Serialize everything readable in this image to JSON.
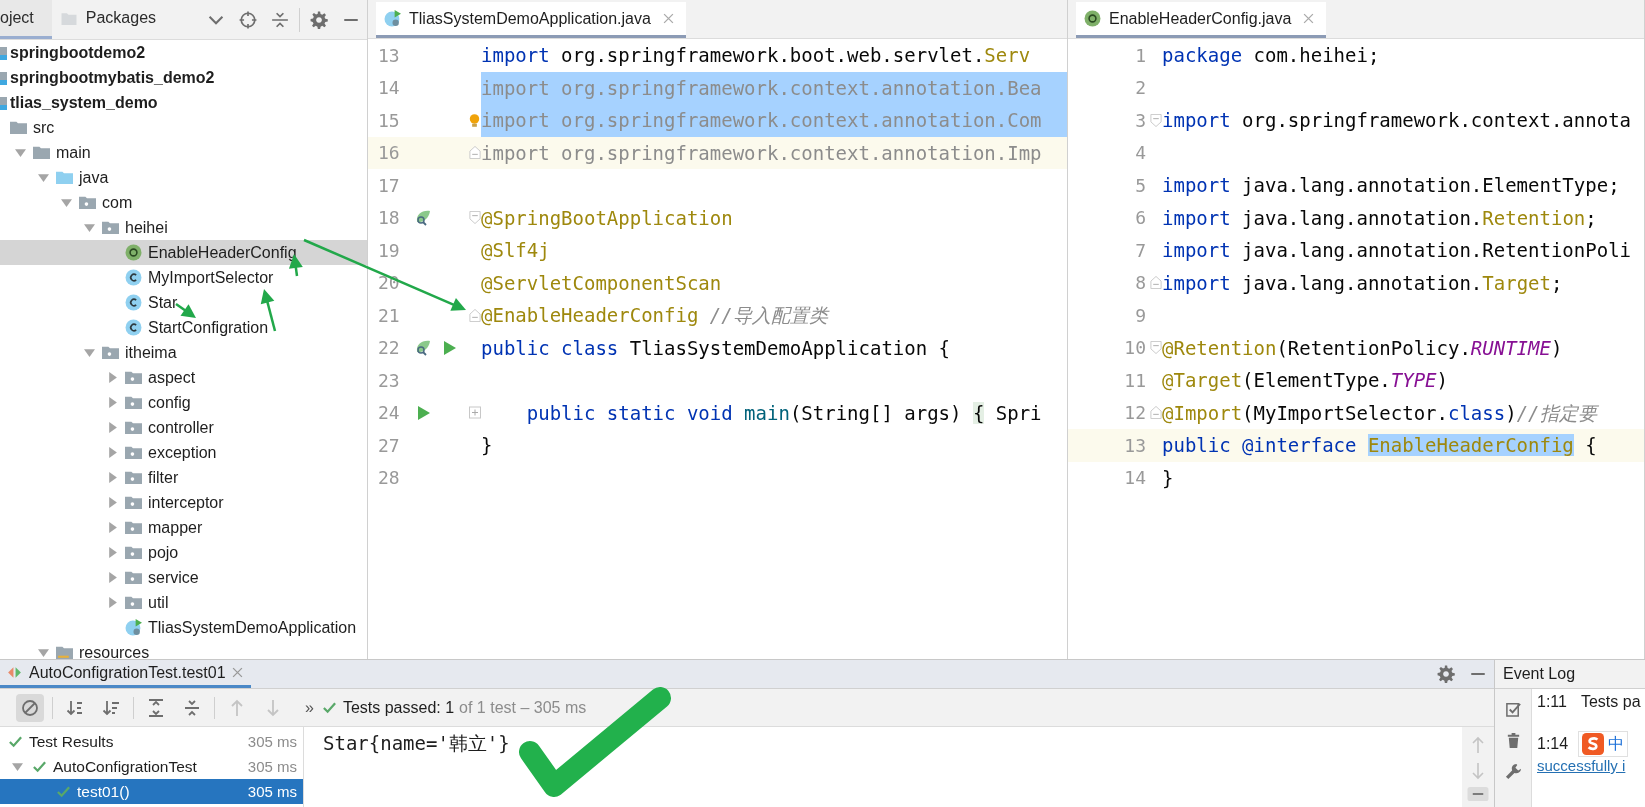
{
  "project": {
    "tabs": [
      {
        "label": "oject",
        "selected": true
      },
      {
        "label": "Packages",
        "selected": false
      }
    ],
    "tree": [
      {
        "label": "springbootdemo2",
        "kind": "module",
        "selected": false
      },
      {
        "label": "springbootmybatis_demo2",
        "kind": "module",
        "selected": false
      },
      {
        "label": "tlias_system_demo",
        "kind": "module",
        "selected": false,
        "children": [
          {
            "label": "src",
            "kind": "folder",
            "selected": false,
            "children": [
              {
                "label": "main",
                "kind": "folder",
                "expanded": true,
                "selected": false,
                "children": [
                  {
                    "label": "java",
                    "kind": "source-root",
                    "expanded": true,
                    "selected": false,
                    "children": [
                      {
                        "label": "com",
                        "kind": "package",
                        "expanded": true,
                        "selected": false,
                        "children": [
                          {
                            "label": "heihei",
                            "kind": "package",
                            "expanded": true,
                            "selected": false,
                            "children": [
                              {
                                "label": "EnableHeaderConfig",
                                "kind": "annotation",
                                "selected": true
                              },
                              {
                                "label": "MyImportSelector",
                                "kind": "class",
                                "selected": false
                              },
                              {
                                "label": "Star",
                                "kind": "class",
                                "selected": false
                              },
                              {
                                "label": "StartConfigration",
                                "kind": "class",
                                "selected": false
                              }
                            ]
                          },
                          {
                            "label": "itheima",
                            "kind": "package",
                            "expanded": true,
                            "selected": false,
                            "children": [
                              {
                                "label": "aspect",
                                "kind": "package",
                                "expanded": false,
                                "selected": false
                              },
                              {
                                "label": "config",
                                "kind": "package",
                                "expanded": false,
                                "selected": false
                              },
                              {
                                "label": "controller",
                                "kind": "package",
                                "expanded": false,
                                "selected": false
                              },
                              {
                                "label": "exception",
                                "kind": "package",
                                "expanded": false,
                                "selected": false
                              },
                              {
                                "label": "filter",
                                "kind": "package",
                                "expanded": false,
                                "selected": false
                              },
                              {
                                "label": "interceptor",
                                "kind": "package",
                                "expanded": false,
                                "selected": false
                              },
                              {
                                "label": "mapper",
                                "kind": "package",
                                "expanded": false,
                                "selected": false
                              },
                              {
                                "label": "pojo",
                                "kind": "package",
                                "expanded": false,
                                "selected": false
                              },
                              {
                                "label": "service",
                                "kind": "package",
                                "expanded": false,
                                "selected": false
                              },
                              {
                                "label": "util",
                                "kind": "package",
                                "expanded": false,
                                "selected": false
                              },
                              {
                                "label": "TliasSystemDemoApplication",
                                "kind": "app-class",
                                "selected": false
                              }
                            ]
                          }
                        ]
                      }
                    ]
                  },
                  {
                    "label": "resources",
                    "kind": "resources",
                    "expanded": true,
                    "selected": false
                  }
                ]
              }
            ]
          }
        ]
      }
    ]
  },
  "editors": [
    {
      "tab": {
        "label": "TliasSystemDemoApplication.java",
        "kind": "app-class",
        "selected": true
      },
      "lines": [
        {
          "num": "13",
          "selected": false,
          "current": false,
          "tokens": [
            {
              "t": "import",
              "kind": "kw"
            },
            {
              "t": " org.springframework.boot.web.servlet.",
              "kind": "plain"
            },
            {
              "t": "Serv",
              "kind": "ann"
            }
          ]
        },
        {
          "num": "14",
          "selected": true,
          "current": false,
          "tokens": [
            {
              "t": "import org.springframework.context.annotation.Bea",
              "kind": "unused"
            }
          ]
        },
        {
          "num": "15",
          "selected": true,
          "current": false,
          "intention": true,
          "tokens": [
            {
              "t": "import org.springframework.context.annotation.Com",
              "kind": "unused"
            }
          ]
        },
        {
          "num": "16",
          "selected": false,
          "current": true,
          "fold_end": true,
          "tokens": [
            {
              "t": "import org.springframework.context.annotation.Imp",
              "kind": "unused"
            }
          ]
        },
        {
          "num": "17",
          "selected": false,
          "current": false
        },
        {
          "num": "18",
          "selected": false,
          "current": false,
          "fold_start": true,
          "bean": true,
          "tokens": [
            {
              "t": "@SpringBootApplication",
              "kind": "ann"
            }
          ]
        },
        {
          "num": "19",
          "selected": false,
          "current": false,
          "tokens": [
            {
              "t": "@Slf4j",
              "kind": "ann"
            }
          ]
        },
        {
          "num": "20",
          "selected": false,
          "current": false,
          "tokens": [
            {
              "t": "@ServletComponentScan",
              "kind": "ann"
            }
          ]
        },
        {
          "num": "21",
          "selected": false,
          "current": false,
          "fold_end": true,
          "tokens": [
            {
              "t": "@EnableHeaderConfig",
              "kind": "ann"
            },
            {
              "t": " //导入配置类",
              "kind": "comment"
            }
          ]
        },
        {
          "num": "22",
          "selected": false,
          "current": false,
          "bean": true,
          "run": true,
          "tokens": [
            {
              "t": "public class",
              "kind": "kw"
            },
            {
              "t": " TliasSystemDemoApplication {",
              "kind": "plain"
            }
          ]
        },
        {
          "num": "23",
          "selected": false,
          "current": false
        },
        {
          "num": "24",
          "selected": false,
          "current": false,
          "collapsed": true,
          "run": true,
          "tokens": [
            {
              "t": "    public static void",
              "kind": "kw"
            },
            {
              "t": " main",
              "kind": "method"
            },
            {
              "t": "(String[] args) ",
              "kind": "plain"
            },
            {
              "t": "{",
              "kind": "folded"
            },
            {
              "t": " Spri",
              "kind": "plain"
            }
          ]
        },
        {
          "num": "27",
          "selected": false,
          "current": false,
          "tokens": [
            {
              "t": "}",
              "kind": "plain"
            }
          ]
        },
        {
          "num": "28",
          "selected": false,
          "current": false
        }
      ]
    },
    {
      "tab": {
        "label": "EnableHeaderConfig.java",
        "kind": "annotation",
        "selected": true
      },
      "lines": [
        {
          "num": "1",
          "selected": false,
          "current": false,
          "tokens": [
            {
              "t": "package",
              "kind": "kw"
            },
            {
              "t": " com.heihei;",
              "kind": "plain"
            }
          ]
        },
        {
          "num": "2",
          "selected": false,
          "current": false
        },
        {
          "num": "3",
          "selected": false,
          "current": false,
          "fold_start": true,
          "tokens": [
            {
              "t": "import",
              "kind": "kw"
            },
            {
              "t": " org.springframework.context.annota",
              "kind": "plain"
            }
          ]
        },
        {
          "num": "4",
          "selected": false,
          "current": false
        },
        {
          "num": "5",
          "selected": false,
          "current": false,
          "tokens": [
            {
              "t": "import",
              "kind": "kw"
            },
            {
              "t": " java.lang.annotation.ElementType;",
              "kind": "plain"
            }
          ]
        },
        {
          "num": "6",
          "selected": false,
          "current": false,
          "tokens": [
            {
              "t": "import",
              "kind": "kw"
            },
            {
              "t": " java.lang.annotation.",
              "kind": "plain"
            },
            {
              "t": "Retention",
              "kind": "ann"
            },
            {
              "t": ";",
              "kind": "plain"
            }
          ]
        },
        {
          "num": "7",
          "selected": false,
          "current": false,
          "tokens": [
            {
              "t": "import",
              "kind": "kw"
            },
            {
              "t": " java.lang.annotation.RetentionPoli",
              "kind": "plain"
            }
          ]
        },
        {
          "num": "8",
          "selected": false,
          "current": false,
          "fold_end": true,
          "tokens": [
            {
              "t": "import",
              "kind": "kw"
            },
            {
              "t": " java.lang.annotation.",
              "kind": "plain"
            },
            {
              "t": "Target",
              "kind": "ann"
            },
            {
              "t": ";",
              "kind": "plain"
            }
          ]
        },
        {
          "num": "9",
          "selected": false,
          "current": false
        },
        {
          "num": "10",
          "selected": false,
          "current": false,
          "fold_start": true,
          "tokens": [
            {
              "t": "@Retention",
              "kind": "ann"
            },
            {
              "t": "(RetentionPolicy.",
              "kind": "plain"
            },
            {
              "t": "RUNTIME",
              "kind": "const"
            },
            {
              "t": ")",
              "kind": "plain"
            }
          ]
        },
        {
          "num": "11",
          "selected": false,
          "current": false,
          "tokens": [
            {
              "t": "@Target",
              "kind": "ann"
            },
            {
              "t": "(ElementType.",
              "kind": "plain"
            },
            {
              "t": "TYPE",
              "kind": "const"
            },
            {
              "t": ")",
              "kind": "plain"
            }
          ]
        },
        {
          "num": "12",
          "selected": false,
          "current": false,
          "fold_end": true,
          "tokens": [
            {
              "t": "@Import",
              "kind": "ann"
            },
            {
              "t": "(MyImportSelector.",
              "kind": "plain"
            },
            {
              "t": "class",
              "kind": "kw"
            },
            {
              "t": ")",
              "kind": "plain"
            },
            {
              "t": "//指定要",
              "kind": "comment"
            }
          ]
        },
        {
          "num": "13",
          "selected": false,
          "current": true,
          "tokens": [
            {
              "t": "public @interface ",
              "kind": "kw"
            },
            {
              "t": "EnableHeaderConfig",
              "kind": "hl"
            },
            {
              "t": " {",
              "kind": "plain"
            }
          ]
        },
        {
          "num": "14",
          "selected": false,
          "current": false,
          "tokens": [
            {
              "t": "}",
              "kind": "plain"
            }
          ]
        }
      ]
    }
  ],
  "run_panel": {
    "tab": {
      "label": "AutoConfigrationTest.test01",
      "selected": true
    },
    "toolbar": [
      {
        "kind": "stop",
        "pressed": true,
        "disabled": false
      },
      {
        "kind": "sort-alpha",
        "pressed": false,
        "disabled": false
      },
      {
        "kind": "sort-duration",
        "pressed": false,
        "disabled": false
      },
      {
        "kind": "expand-all",
        "pressed": false,
        "disabled": false
      },
      {
        "kind": "collapse-all",
        "pressed": false,
        "disabled": false
      },
      {
        "kind": "up",
        "pressed": false,
        "disabled": true
      },
      {
        "kind": "down",
        "pressed": false,
        "disabled": true
      }
    ],
    "overflow": "»",
    "status": {
      "passed": "Tests passed: 1",
      "detail": "of 1 test – 305 ms"
    },
    "tests": [
      {
        "name": "Test Results",
        "time": "305 ms",
        "passed": true,
        "selected": false,
        "children": [
          {
            "name": "AutoConfigrationTest",
            "time": "305 ms",
            "passed": true,
            "expanded": true,
            "selected": false,
            "children": [
              {
                "name": "test01()",
                "time": "305 ms",
                "passed": true,
                "selected": true
              }
            ]
          }
        ]
      }
    ],
    "output": "Star{name='韩立'}"
  },
  "event_log": {
    "title": "Event Log",
    "entries": [
      {
        "time": "1:11",
        "text": "Tests pa"
      },
      {
        "time": "1:14",
        "link": "successfully i"
      }
    ]
  },
  "ime": {
    "mode": "中"
  }
}
